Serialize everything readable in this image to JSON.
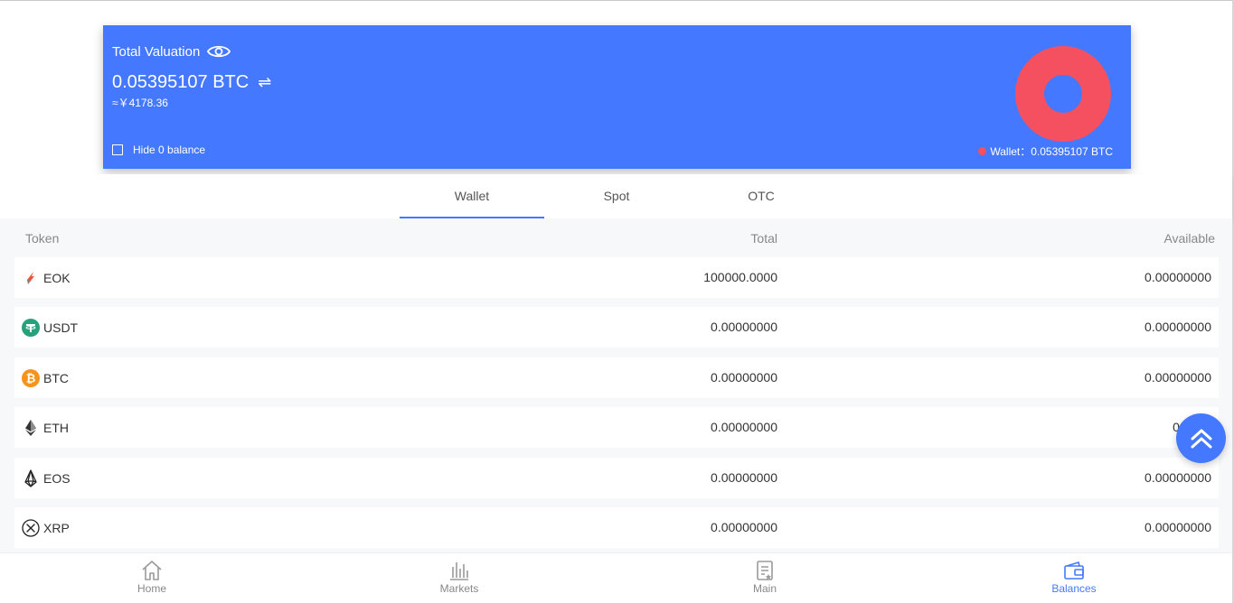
{
  "card": {
    "title": "Total Valuation",
    "btc_amount": "0.05395107 BTC",
    "cny_amount": "≈￥4178.36",
    "hide_label": "Hide 0 balance",
    "legend_label": "Wallet：0.05395107 BTC",
    "accent_color": "#4479ff",
    "donut_color": "#f4505f"
  },
  "tabs": [
    {
      "label": "Wallet",
      "active": true
    },
    {
      "label": "Spot",
      "active": false
    },
    {
      "label": "OTC",
      "active": false
    }
  ],
  "table": {
    "headers": {
      "token": "Token",
      "total": "Total",
      "available": "Available"
    },
    "rows": [
      {
        "token": "EOK",
        "icon": "eok-icon",
        "total": "100000.0000",
        "available": "0.00000000"
      },
      {
        "token": "USDT",
        "icon": "usdt-icon",
        "total": "0.00000000",
        "available": "0.00000000"
      },
      {
        "token": "BTC",
        "icon": "btc-icon",
        "total": "0.00000000",
        "available": "0.00000000"
      },
      {
        "token": "ETH",
        "icon": "eth-icon",
        "total": "0.00000000",
        "available": "0.0000"
      },
      {
        "token": "EOS",
        "icon": "eos-icon",
        "total": "0.00000000",
        "available": "0.00000000"
      },
      {
        "token": "XRP",
        "icon": "xrp-icon",
        "total": "0.00000000",
        "available": "0.00000000"
      }
    ]
  },
  "nav": {
    "items": [
      {
        "label": "Home",
        "icon": "home-icon",
        "active": false
      },
      {
        "label": "Markets",
        "icon": "markets-icon",
        "active": false
      },
      {
        "label": "Main",
        "icon": "main-icon",
        "active": false
      },
      {
        "label": "Balances",
        "icon": "wallet-icon",
        "active": true
      }
    ]
  }
}
